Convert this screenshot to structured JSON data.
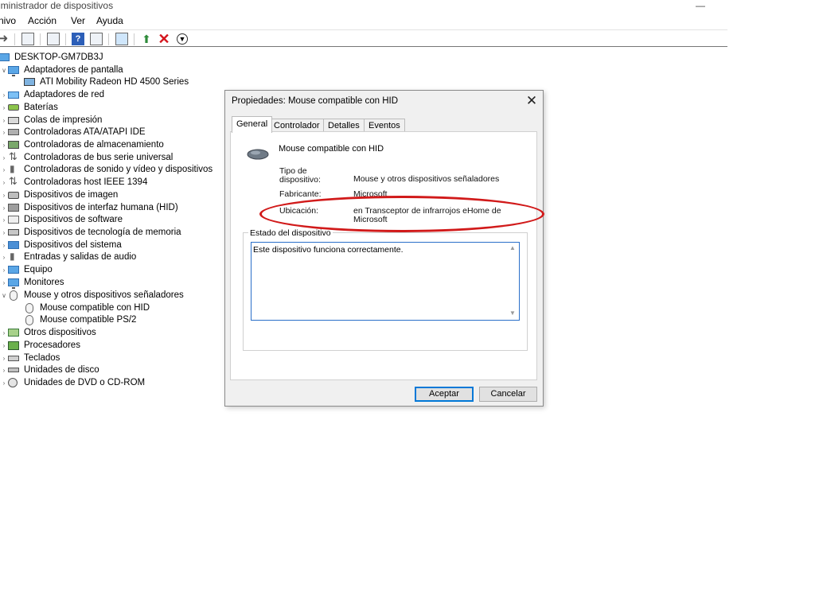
{
  "window": {
    "title": "dministrador de dispositivos",
    "minimize_glyph": "—"
  },
  "menu": [
    "nivo",
    "Acción",
    "Ver",
    "Ayuda"
  ],
  "toolbar": {
    "icons": [
      "back-arrow-icon",
      "properties-icon",
      "driver-icon",
      "help-icon",
      "view-icon",
      "scan-hardware-icon",
      "update-driver-icon",
      "uninstall-icon",
      "download-icon"
    ]
  },
  "tree": {
    "root": "DESKTOP-GM7DB3J",
    "items": [
      {
        "label": "Adaptadores de pantalla",
        "icon": "display-adapter-icon",
        "expanded": true
      },
      {
        "label": "ATI Mobility Radeon HD 4500 Series",
        "icon": "gpu-icon",
        "child": true
      },
      {
        "label": "Adaptadores de red",
        "icon": "network-adapter-icon"
      },
      {
        "label": "Baterías",
        "icon": "battery-icon"
      },
      {
        "label": "Colas de impresión",
        "icon": "printer-icon"
      },
      {
        "label": "Controladoras ATA/ATAPI IDE",
        "icon": "ide-controller-icon"
      },
      {
        "label": "Controladoras de almacenamiento",
        "icon": "storage-controller-icon"
      },
      {
        "label": "Controladoras de bus serie universal",
        "icon": "usb-icon"
      },
      {
        "label": "Controladoras de sonido y vídeo y dispositivos",
        "icon": "sound-icon"
      },
      {
        "label": "Controladoras host IEEE 1394",
        "icon": "firewire-icon"
      },
      {
        "label": "Dispositivos de imagen",
        "icon": "camera-icon"
      },
      {
        "label": "Dispositivos de interfaz humana (HID)",
        "icon": "hid-icon"
      },
      {
        "label": "Dispositivos de software",
        "icon": "software-device-icon"
      },
      {
        "label": "Dispositivos de tecnología de memoria",
        "icon": "memory-icon"
      },
      {
        "label": "Dispositivos del sistema",
        "icon": "system-device-icon"
      },
      {
        "label": "Entradas y salidas de audio",
        "icon": "audio-io-icon"
      },
      {
        "label": "Equipo",
        "icon": "computer-icon"
      },
      {
        "label": "Monitores",
        "icon": "monitor-icon"
      },
      {
        "label": "Mouse y otros dispositivos señaladores",
        "icon": "mouse-icon",
        "expanded": true
      },
      {
        "label": "Mouse compatible con HID",
        "icon": "mouse-icon",
        "child": true
      },
      {
        "label": "Mouse compatible PS/2",
        "icon": "mouse-icon",
        "child": true
      },
      {
        "label": "Otros dispositivos",
        "icon": "other-device-icon"
      },
      {
        "label": "Procesadores",
        "icon": "cpu-icon"
      },
      {
        "label": "Teclados",
        "icon": "keyboard-icon"
      },
      {
        "label": "Unidades de disco",
        "icon": "disk-icon"
      },
      {
        "label": "Unidades de DVD o CD-ROM",
        "icon": "dvd-icon"
      }
    ]
  },
  "dialog": {
    "title": "Propiedades: Mouse compatible con HID",
    "close_glyph": "✕",
    "tabs": [
      "General",
      "Controlador",
      "Detalles",
      "Eventos"
    ],
    "active_tab": "General",
    "device_name": "Mouse compatible con HID",
    "props": {
      "type_label_1": "Tipo de",
      "type_label_2": "dispositivo:",
      "type_value": "Mouse y otros dispositivos señaladores",
      "manufacturer_label": "Fabricante:",
      "manufacturer_value": "Microsoft",
      "location_label": "Ubicación:",
      "location_value_1": "en Transceptor de infrarrojos eHome de",
      "location_value_2": "Microsoft"
    },
    "status_legend": "Estado del dispositivo",
    "status_text": "Este dispositivo funciona correctamente.",
    "ok_label": "Aceptar",
    "cancel_label": "Cancelar"
  },
  "colors": {
    "annotation": "#d11a1a",
    "focus_border": "#2a6fc9",
    "dialog_bg": "#f0f0f0"
  }
}
